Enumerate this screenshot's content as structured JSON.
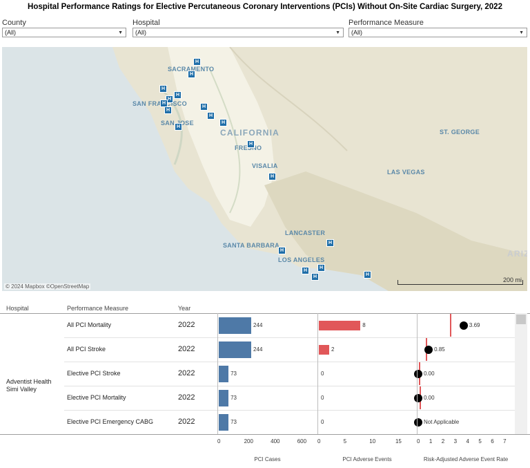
{
  "title": "Hospital Performance Ratings for Elective Percutaneous Coronary Interventions (PCIs) Without On-Site Cardiac Surgery, 2022",
  "filters": {
    "county": {
      "label": "County",
      "value": "(All)"
    },
    "hospital": {
      "label": "Hospital",
      "value": "(All)"
    },
    "measure": {
      "label": "Performance Measure",
      "value": "(All)"
    }
  },
  "map": {
    "region_label": "CALIFORNIA",
    "attribution": "© 2024 Mapbox ©OpenStreetMap",
    "scale_label": "200 mi",
    "cities": [
      "SACRAMENTO",
      "SAN FRANCISCO",
      "SAN JOSE",
      "FRESNO",
      "VISALIA",
      "ST. GEORGE",
      "LAS VEGAS",
      "LANCASTER",
      "SANTA BARBARA",
      "LOS ANGELES",
      "ARIZ"
    ],
    "marker_glyph": "H"
  },
  "table": {
    "headers": {
      "hospital": "Hospital",
      "measure": "Performance Measure",
      "year": "Year"
    },
    "hospital_name_line1": "Adventist Health",
    "hospital_name_line2": "Simi Valley",
    "rows": [
      {
        "measure": "All PCI Mortality",
        "year": "2022",
        "cases": 244,
        "events": 8,
        "rate": 3.69,
        "benchmark": 2.6,
        "rate_label": "3.69"
      },
      {
        "measure": "All PCI Stroke",
        "year": "2022",
        "cases": 244,
        "events": 2,
        "rate": 0.85,
        "benchmark": 0.6,
        "rate_label": "0.85"
      },
      {
        "measure": "Elective PCI Stroke",
        "year": "2022",
        "cases": 73,
        "events": 0,
        "rate": 0.0,
        "benchmark": 0.05,
        "rate_label": "0.00"
      },
      {
        "measure": "Elective PCI Mortality",
        "year": "2022",
        "cases": 73,
        "events": 0,
        "rate": 0.0,
        "benchmark": 0.1,
        "rate_label": "0.00"
      },
      {
        "measure": "Elective PCI Emergency CABG",
        "year": "2022",
        "cases": 73,
        "events": 0,
        "rate": 0.0,
        "benchmark": null,
        "rate_label": "Not Applicable"
      }
    ]
  },
  "axes": {
    "cases": {
      "title": "PCI Cases",
      "ticks": [
        "0",
        "200",
        "400",
        "600"
      ],
      "max": 700
    },
    "events": {
      "title": "PCI Adverse Events",
      "ticks": [
        "0",
        "5",
        "10",
        "15"
      ],
      "max": 17
    },
    "rate": {
      "title": "Risk-Adjusted Adverse Event Rate",
      "ticks": [
        "0",
        "1",
        "2",
        "3",
        "4",
        "5",
        "6",
        "7"
      ],
      "max": 7.5
    }
  },
  "colors": {
    "cases_bar": "#4e79a7",
    "events_bar": "#e15759",
    "benchmark": "#e15759",
    "marker": "#000000"
  }
}
